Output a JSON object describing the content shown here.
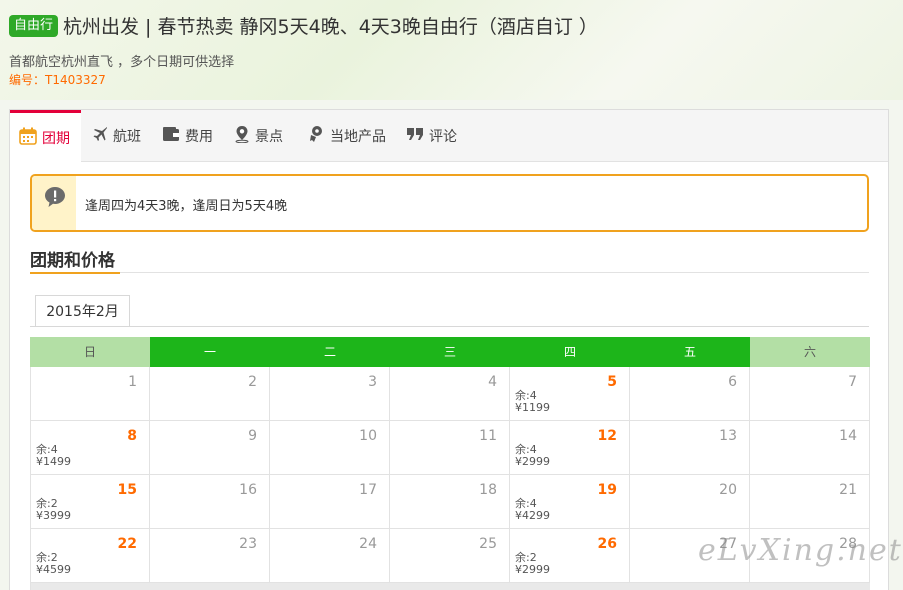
{
  "header": {
    "badge": "自由行",
    "title": "杭州出发 | 春节热卖 静冈5天4晚、4天3晚自由行（酒店自订 ）",
    "subtitle": "首都航空杭州直飞 ，多个日期可供选择",
    "code": "编号：T1403327"
  },
  "tabs": [
    {
      "label": "团期",
      "icon": "calendar-icon"
    },
    {
      "label": "航班",
      "icon": "plane-icon"
    },
    {
      "label": "费用",
      "icon": "wallet-icon"
    },
    {
      "label": "景点",
      "icon": "location-pin-icon"
    },
    {
      "label": "当地产品",
      "icon": "local-product-icon"
    },
    {
      "label": "评论",
      "icon": "comment-icon"
    }
  ],
  "notice": {
    "text": "逢周四为4天3晚，逢周日为5天4晚"
  },
  "section": {
    "title": "团期和价格"
  },
  "calendar": {
    "month": "2015年2月",
    "weekdays": [
      "日",
      "一",
      "二",
      "三",
      "四",
      "五",
      "六"
    ],
    "rows": [
      [
        {
          "d": "1"
        },
        {
          "d": "2"
        },
        {
          "d": "3"
        },
        {
          "d": "4"
        },
        {
          "d": "5",
          "rem": "余:4",
          "price": "¥1199"
        },
        {
          "d": "6"
        },
        {
          "d": "7"
        }
      ],
      [
        {
          "d": "8",
          "rem": "余:4",
          "price": "¥1499"
        },
        {
          "d": "9"
        },
        {
          "d": "10"
        },
        {
          "d": "11"
        },
        {
          "d": "12",
          "rem": "余:4",
          "price": "¥2999"
        },
        {
          "d": "13"
        },
        {
          "d": "14"
        }
      ],
      [
        {
          "d": "15",
          "rem": "余:2",
          "price": "¥3999"
        },
        {
          "d": "16"
        },
        {
          "d": "17"
        },
        {
          "d": "18"
        },
        {
          "d": "19",
          "rem": "余:4",
          "price": "¥4299"
        },
        {
          "d": "20"
        },
        {
          "d": "21"
        }
      ],
      [
        {
          "d": "22",
          "rem": "余:2",
          "price": "¥4599"
        },
        {
          "d": "23"
        },
        {
          "d": "24"
        },
        {
          "d": "25"
        },
        {
          "d": "26",
          "rem": "余:2",
          "price": "¥2999"
        },
        {
          "d": "27"
        },
        {
          "d": "28"
        }
      ]
    ]
  },
  "watermark": "eLvXing.net",
  "colors": {
    "accent_green": "#1db51a",
    "accent_orange": "#ff6a00",
    "tab_red": "#e3003a",
    "notice_border": "#f0a21e"
  }
}
